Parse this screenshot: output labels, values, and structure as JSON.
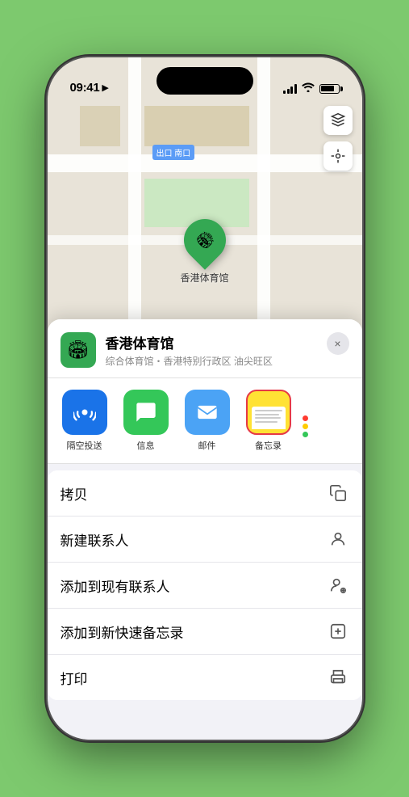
{
  "status_bar": {
    "time": "09:41",
    "location_arrow": "▶"
  },
  "map": {
    "label": "南口",
    "label_prefix": "出口",
    "pin_name": "香港体育馆",
    "layers_icon": "🗺",
    "location_icon": "◎"
  },
  "venue": {
    "name": "香港体育馆",
    "description": "综合体育馆・香港特别行政区 油尖旺区",
    "close_label": "×",
    "icon": "🏟"
  },
  "share_items": [
    {
      "label": "隔空投送",
      "type": "airdrop"
    },
    {
      "label": "信息",
      "type": "message"
    },
    {
      "label": "邮件",
      "type": "mail"
    },
    {
      "label": "备忘录",
      "type": "notes"
    }
  ],
  "more_dots": [
    "#ff3b30",
    "#ffcc00",
    "#34c759"
  ],
  "actions": [
    {
      "label": "拷贝",
      "icon": "copy"
    },
    {
      "label": "新建联系人",
      "icon": "person"
    },
    {
      "label": "添加到现有联系人",
      "icon": "person-add"
    },
    {
      "label": "添加到新快速备忘录",
      "icon": "note"
    },
    {
      "label": "打印",
      "icon": "print"
    }
  ]
}
